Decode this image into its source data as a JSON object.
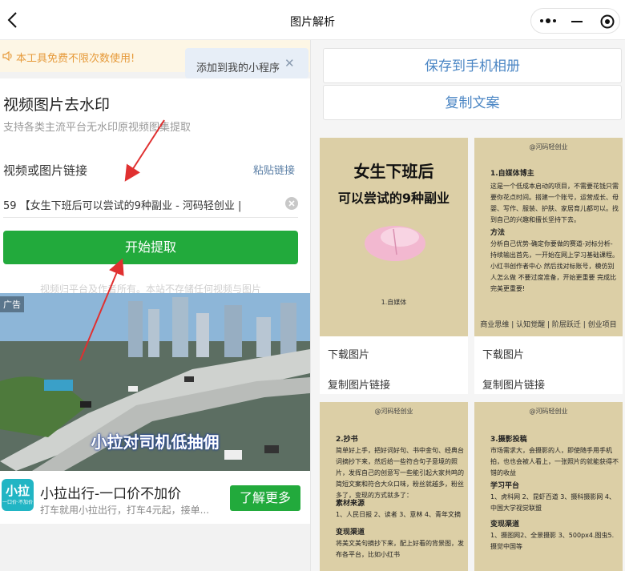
{
  "nav": {
    "title": "图片解析"
  },
  "notice": {
    "text": "本工具免费不限次数使用!"
  },
  "tip": {
    "text": "添加到我的小程序",
    "close": "✕"
  },
  "form": {
    "heading": "视频图片去水印",
    "subheading": "支持各类主流平台无水印原视频图集提取",
    "link_label": "视频或图片链接",
    "paste": "粘贴链接",
    "input_value": "59 【女生下班后可以尝试的9种副业 - 河码轻创业 |",
    "start": "开始提取",
    "disclaimer": "视频归平台及作者所有。本站不存储任何视频与图片"
  },
  "ad": {
    "tag": "广告",
    "caption": "小拉对司机低抽佣",
    "logo": "小拉",
    "logo_sub": "一口价·不加价",
    "title": "小拉出行-一口价不加价",
    "desc": "打车就用小拉出行，打车4元起，接单...",
    "more": "了解更多"
  },
  "actions": {
    "save": "保存到手机相册",
    "copy_text": "复制文案"
  },
  "tiles": [
    {
      "brand": "",
      "big1": "女生下班后",
      "big2": "可以尝试的9种副业",
      "note": "1.自媒体",
      "download": "下载图片",
      "copy": "复制图片链接"
    },
    {
      "brand": "@河码轻创业",
      "download": "下载图片",
      "copy": "复制图片链接",
      "h1": "1.自媒体博主",
      "p1": "这是一个低成本启动的项目，不需要花钱只需要你花点时间。搭建一个账号，运营成长、母婴、写作、服装、护肤、家居育儿都可以。找到自己的兴趣和擅长坚持下去。",
      "h2": "方法",
      "p2": "分析自己优势-确定你要做的赛道-对标分析-持续输出首先，一开始在网上学习基础课程。小红书创作者中心 然后找对标账号，模仿别人怎么做 不要过度准备，开始更重要 完成比完美更重要!",
      "foot": "商业思维 | 认知觉醒 | 阶层跃迁 | 创业项目"
    },
    {
      "brand": "@河码轻创业",
      "h1": "2.抄书",
      "p1": "简单好上手，把好词好句、书中金句、经典台词摘抄下来，然后给一些符合句子意境的照片，发挥自己的创意写一些能引起大家共鸣的简短文案和符合大众口味，粉丝就越多，粉丝多了，变现的方式就多了：",
      "h2": "素材来源",
      "p2": "1、人民日报 2、读者 3、意林 4、青年文摘",
      "h3": "变现渠道",
      "p3": "将美文美句摘抄下来，配上好看的背景图，发布各平台，比如小红书"
    },
    {
      "brand": "@河码轻创业",
      "h1": "3.摄影投稿",
      "p1": "市场需求大，会摄影的人，即使随手用手机拍，也也会被人看上，一张照片的就能获得不错的收益",
      "h2": "学习平台",
      "p2": "1、虎科网 2、昆虾百道 3、摄科摄影网 4、中国大学视觉联盟",
      "h3": "变现渠道",
      "p3": "1、摄图网2、全景摄影 3、500px4.图虫5.摄觉中国等"
    }
  ]
}
